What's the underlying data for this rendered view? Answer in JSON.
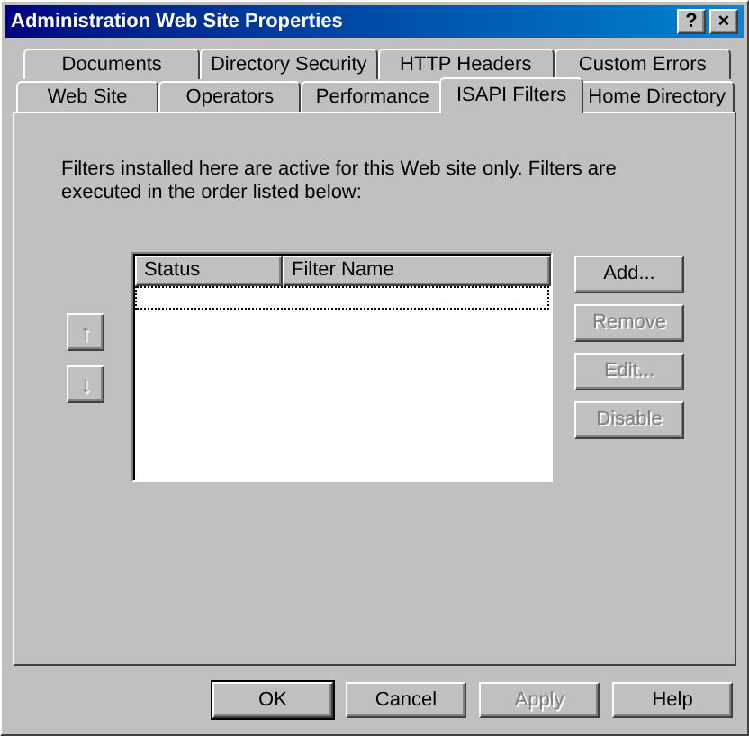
{
  "window": {
    "title": "Administration Web Site Properties",
    "title_buttons": [
      "?",
      "×"
    ]
  },
  "tab_rows": [
    [
      {
        "label": "Documents",
        "selected": false
      },
      {
        "label": "Directory Security",
        "selected": false
      },
      {
        "label": "HTTP Headers",
        "selected": false
      },
      {
        "label": "Custom Errors",
        "selected": false
      }
    ],
    [
      {
        "label": "Web Site",
        "selected": false
      },
      {
        "label": "Operators",
        "selected": false
      },
      {
        "label": "Performance",
        "selected": false
      },
      {
        "label": "ISAPI Filters",
        "selected": true
      },
      {
        "label": "Home Directory",
        "selected": false
      }
    ]
  ],
  "description": "Filters installed here are active for this Web site only. Filters are executed in the order listed below:",
  "order_buttons": [
    {
      "symbol": "↑",
      "disabled": true
    },
    {
      "symbol": "↓",
      "disabled": true
    }
  ],
  "filter_list": {
    "columns": [
      "Status",
      "Filter Name"
    ]
  },
  "side_buttons": [
    {
      "label": "Add...",
      "disabled": false
    },
    {
      "label": "Remove",
      "disabled": true
    },
    {
      "label": "Edit...",
      "disabled": true
    },
    {
      "label": "Disable",
      "disabled": true
    }
  ],
  "dialog_buttons": [
    {
      "label": "OK",
      "disabled": false,
      "default": true
    },
    {
      "label": "Cancel",
      "disabled": false,
      "default": false
    },
    {
      "label": "Apply",
      "disabled": true,
      "default": false
    },
    {
      "label": "Help",
      "disabled": false,
      "default": false
    }
  ]
}
